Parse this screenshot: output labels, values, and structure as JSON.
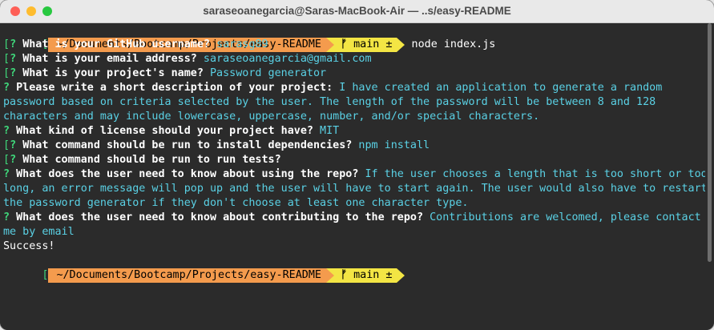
{
  "window": {
    "title": "saraseoanegarcia@Saras-MacBook-Air — ..s/easy-README"
  },
  "prompt": {
    "path": "~/Documents/Bootcamp/Projects/easy-README",
    "branch_icon": "branch-icon",
    "branch": "main ±",
    "command": "node index.js"
  },
  "qa": [
    {
      "question": "What is your GitHub username?",
      "answer": "sarasg89"
    },
    {
      "question": "What is your email address?",
      "answer": "saraseoanegarcia@gmail.com"
    },
    {
      "question": "What is your project's name?",
      "answer": "Password generator"
    },
    {
      "question": "Please write a short description of your project:",
      "answer": "I have created an application to generate a random",
      "cont": [
        "password based on criteria selected by the user. The length of the password will be between 8 and 128",
        "characters and may include lowercase, uppercase, number, and/or special characters."
      ]
    },
    {
      "question": "What kind of license should your project have?",
      "answer": "MIT"
    },
    {
      "question": "What command should be run to install dependencies?",
      "answer": "npm install"
    },
    {
      "question": "What command should be run to run tests?",
      "answer": ""
    },
    {
      "question": "What does the user need to know about using the repo?",
      "answer": "If the user chooses a length that is too short or too",
      "cont": [
        "long, an error message will pop up and the user will have to start again. The user would also have to restart",
        "the password generator if they don't choose at least one character type."
      ]
    },
    {
      "question": "What does the user need to know about contributing to the repo?",
      "answer": "Contributions are welcomed, please contact",
      "cont": [
        "me by email"
      ]
    }
  ],
  "qmark": "?",
  "success": "Success!",
  "colors": {
    "path_bg": "#f49b4d",
    "branch_bg": "#f3e544",
    "answer": "#5ad1e5",
    "qmark": "#3fd67a",
    "terminal_bg": "#2b2b2b"
  }
}
